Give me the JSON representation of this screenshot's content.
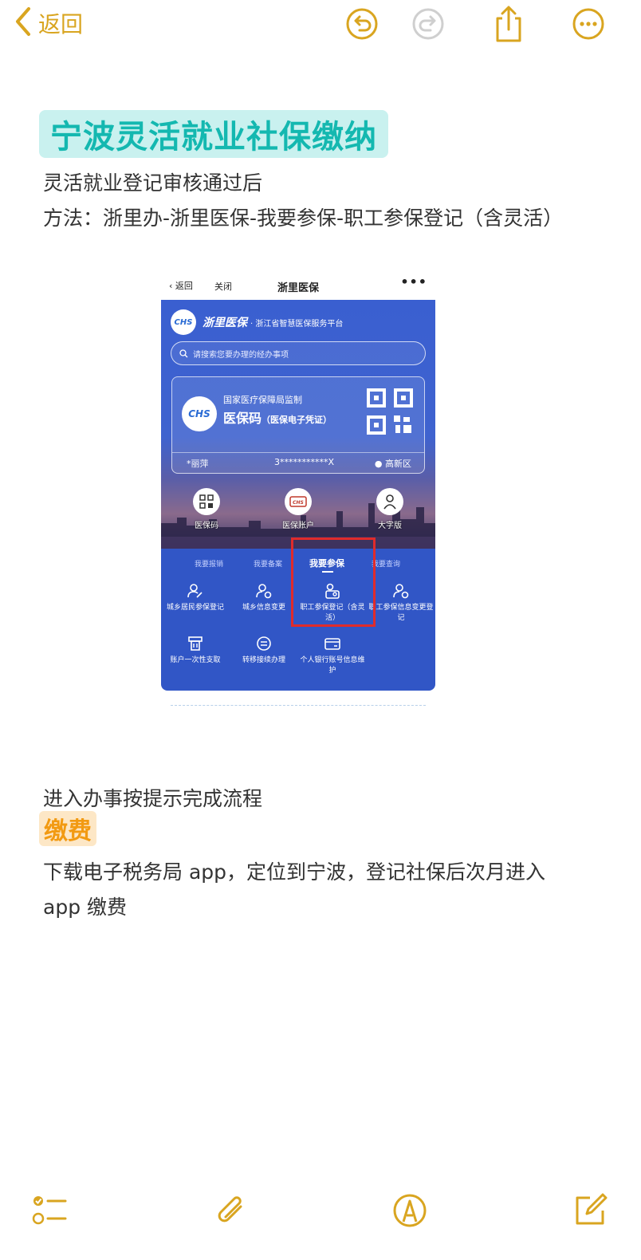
{
  "accent_color": "#d9a520",
  "topbar": {
    "back_label": "返回",
    "icons": [
      "undo-icon",
      "redo-icon",
      "share-icon",
      "more-icon"
    ]
  },
  "note": {
    "title": "宁波灵活就业社保缴纳",
    "line1": "灵活就业登记审核通过后",
    "line2": "方法：浙里办-浙里医保-我要参保-职工参保登记（含灵活）",
    "line3": "进入办事按提示完成流程",
    "pay_heading": "缴费",
    "line4": "下载电子税务局 app，定位到宁波，登记社保后次月进入",
    "line5": "app 缴费"
  },
  "screenshot": {
    "nav": {
      "back": "返回",
      "close": "关闭",
      "title": "浙里医保",
      "more": "•••"
    },
    "brand": {
      "logo": "CHS",
      "name": "浙里医保",
      "subtitle": "· 浙江省智慧医保服务平台"
    },
    "search_placeholder": "请搜索您要办理的经办事项",
    "card": {
      "logo": "CHS",
      "org": "国家医疗保障局监制",
      "code_title": "医保码",
      "code_sub": "（医保电子凭证）",
      "name": "*丽萍",
      "id": "3***********X",
      "region": "高新区"
    },
    "quick": [
      {
        "label": "医保码"
      },
      {
        "label": "医保账户"
      },
      {
        "label": "大字版"
      }
    ],
    "tabs": [
      "我要报销",
      "我要备案",
      "我要参保",
      "我要查询"
    ],
    "active_tab": "我要参保",
    "services": [
      {
        "label": "城乡居民参保登记"
      },
      {
        "label": "城乡信息变更"
      },
      {
        "label": "职工参保登记（含灵活）"
      },
      {
        "label": "职工参保信息变更登记"
      },
      {
        "label": "账户一次性支取"
      },
      {
        "label": "转移接续办理"
      },
      {
        "label": "个人银行账号信息维护"
      }
    ]
  },
  "bottom_toolbar": {
    "icons": [
      "checklist-icon",
      "paperclip-icon",
      "markup-icon",
      "compose-icon"
    ]
  }
}
